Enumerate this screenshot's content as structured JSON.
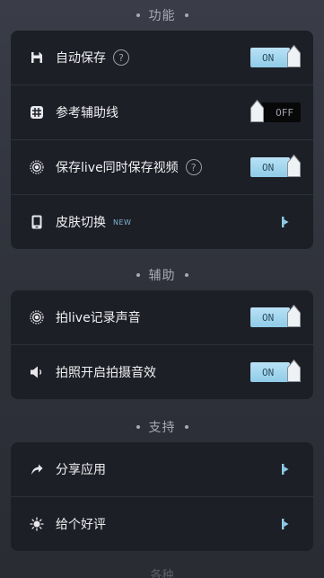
{
  "sections": {
    "features": {
      "title": "功能",
      "rows": {
        "autosave": {
          "label": "自动保存",
          "help": "?",
          "toggle": "ON"
        },
        "guides": {
          "label": "参考辅助线",
          "toggle": "OFF"
        },
        "save_live": {
          "label": "保存live同时保存视频",
          "help": "?",
          "toggle": "ON"
        },
        "skin": {
          "label": "皮肤切换",
          "badge": "NEW"
        }
      }
    },
    "assist": {
      "title": "辅助",
      "rows": {
        "live_audio": {
          "label": "拍live记录声音",
          "toggle": "ON"
        },
        "shutter_sound": {
          "label": "拍照开启拍摄音效",
          "toggle": "ON"
        }
      }
    },
    "support": {
      "title": "支持",
      "rows": {
        "share": {
          "label": "分享应用"
        },
        "rate": {
          "label": "给个好评"
        }
      }
    },
    "next": {
      "title": "各种"
    }
  },
  "icons": {
    "autosave": "save-icon",
    "guides": "grid-icon",
    "save_live": "live-photo-icon",
    "skin": "phone-icon",
    "live_audio": "live-photo-icon",
    "shutter_sound": "speaker-icon",
    "share": "share-icon",
    "rate": "sparkle-icon"
  },
  "colors": {
    "toggle_on": "#a6d8f0",
    "toggle_off": "#080808",
    "card_bg": "#1d1f26",
    "arrow": "#8fcbe8"
  }
}
